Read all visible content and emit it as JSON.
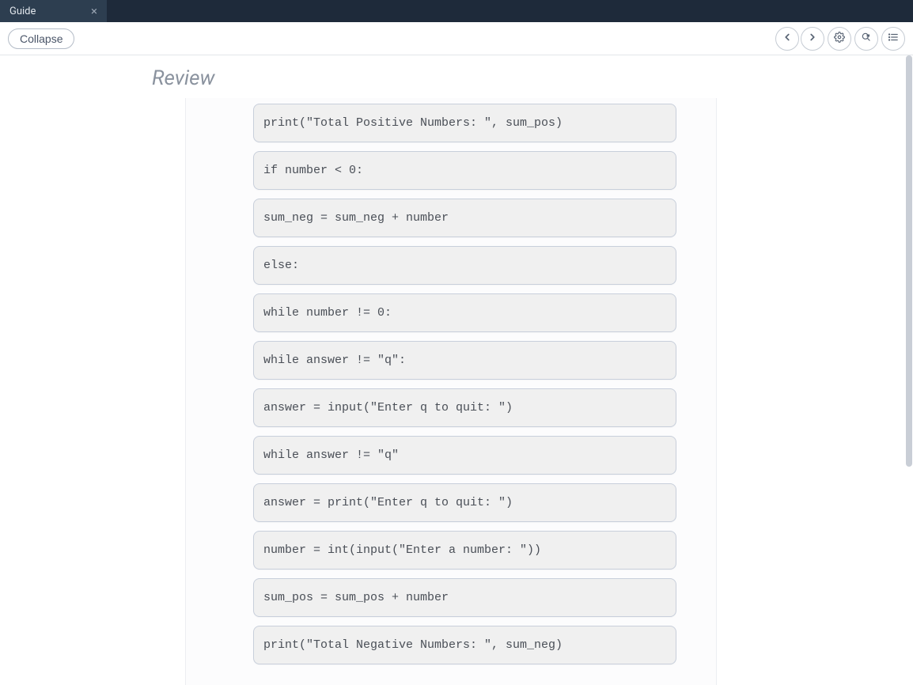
{
  "tab": {
    "title": "Guide"
  },
  "toolbar": {
    "collapse_label": "Collapse"
  },
  "page": {
    "heading": "Review"
  },
  "code_blocks": [
    "print(\"Total Positive Numbers: \", sum_pos)",
    "if number < 0:",
    "sum_neg = sum_neg + number",
    "else:",
    "while number != 0:",
    "while answer != \"q\":",
    "answer = input(\"Enter q to quit: \")",
    "while answer != \"q\"",
    "answer = print(\"Enter q to quit: \")",
    "number = int(input(\"Enter a number: \"))",
    "sum_pos = sum_pos + number",
    "print(\"Total Negative Numbers: \", sum_neg)"
  ]
}
